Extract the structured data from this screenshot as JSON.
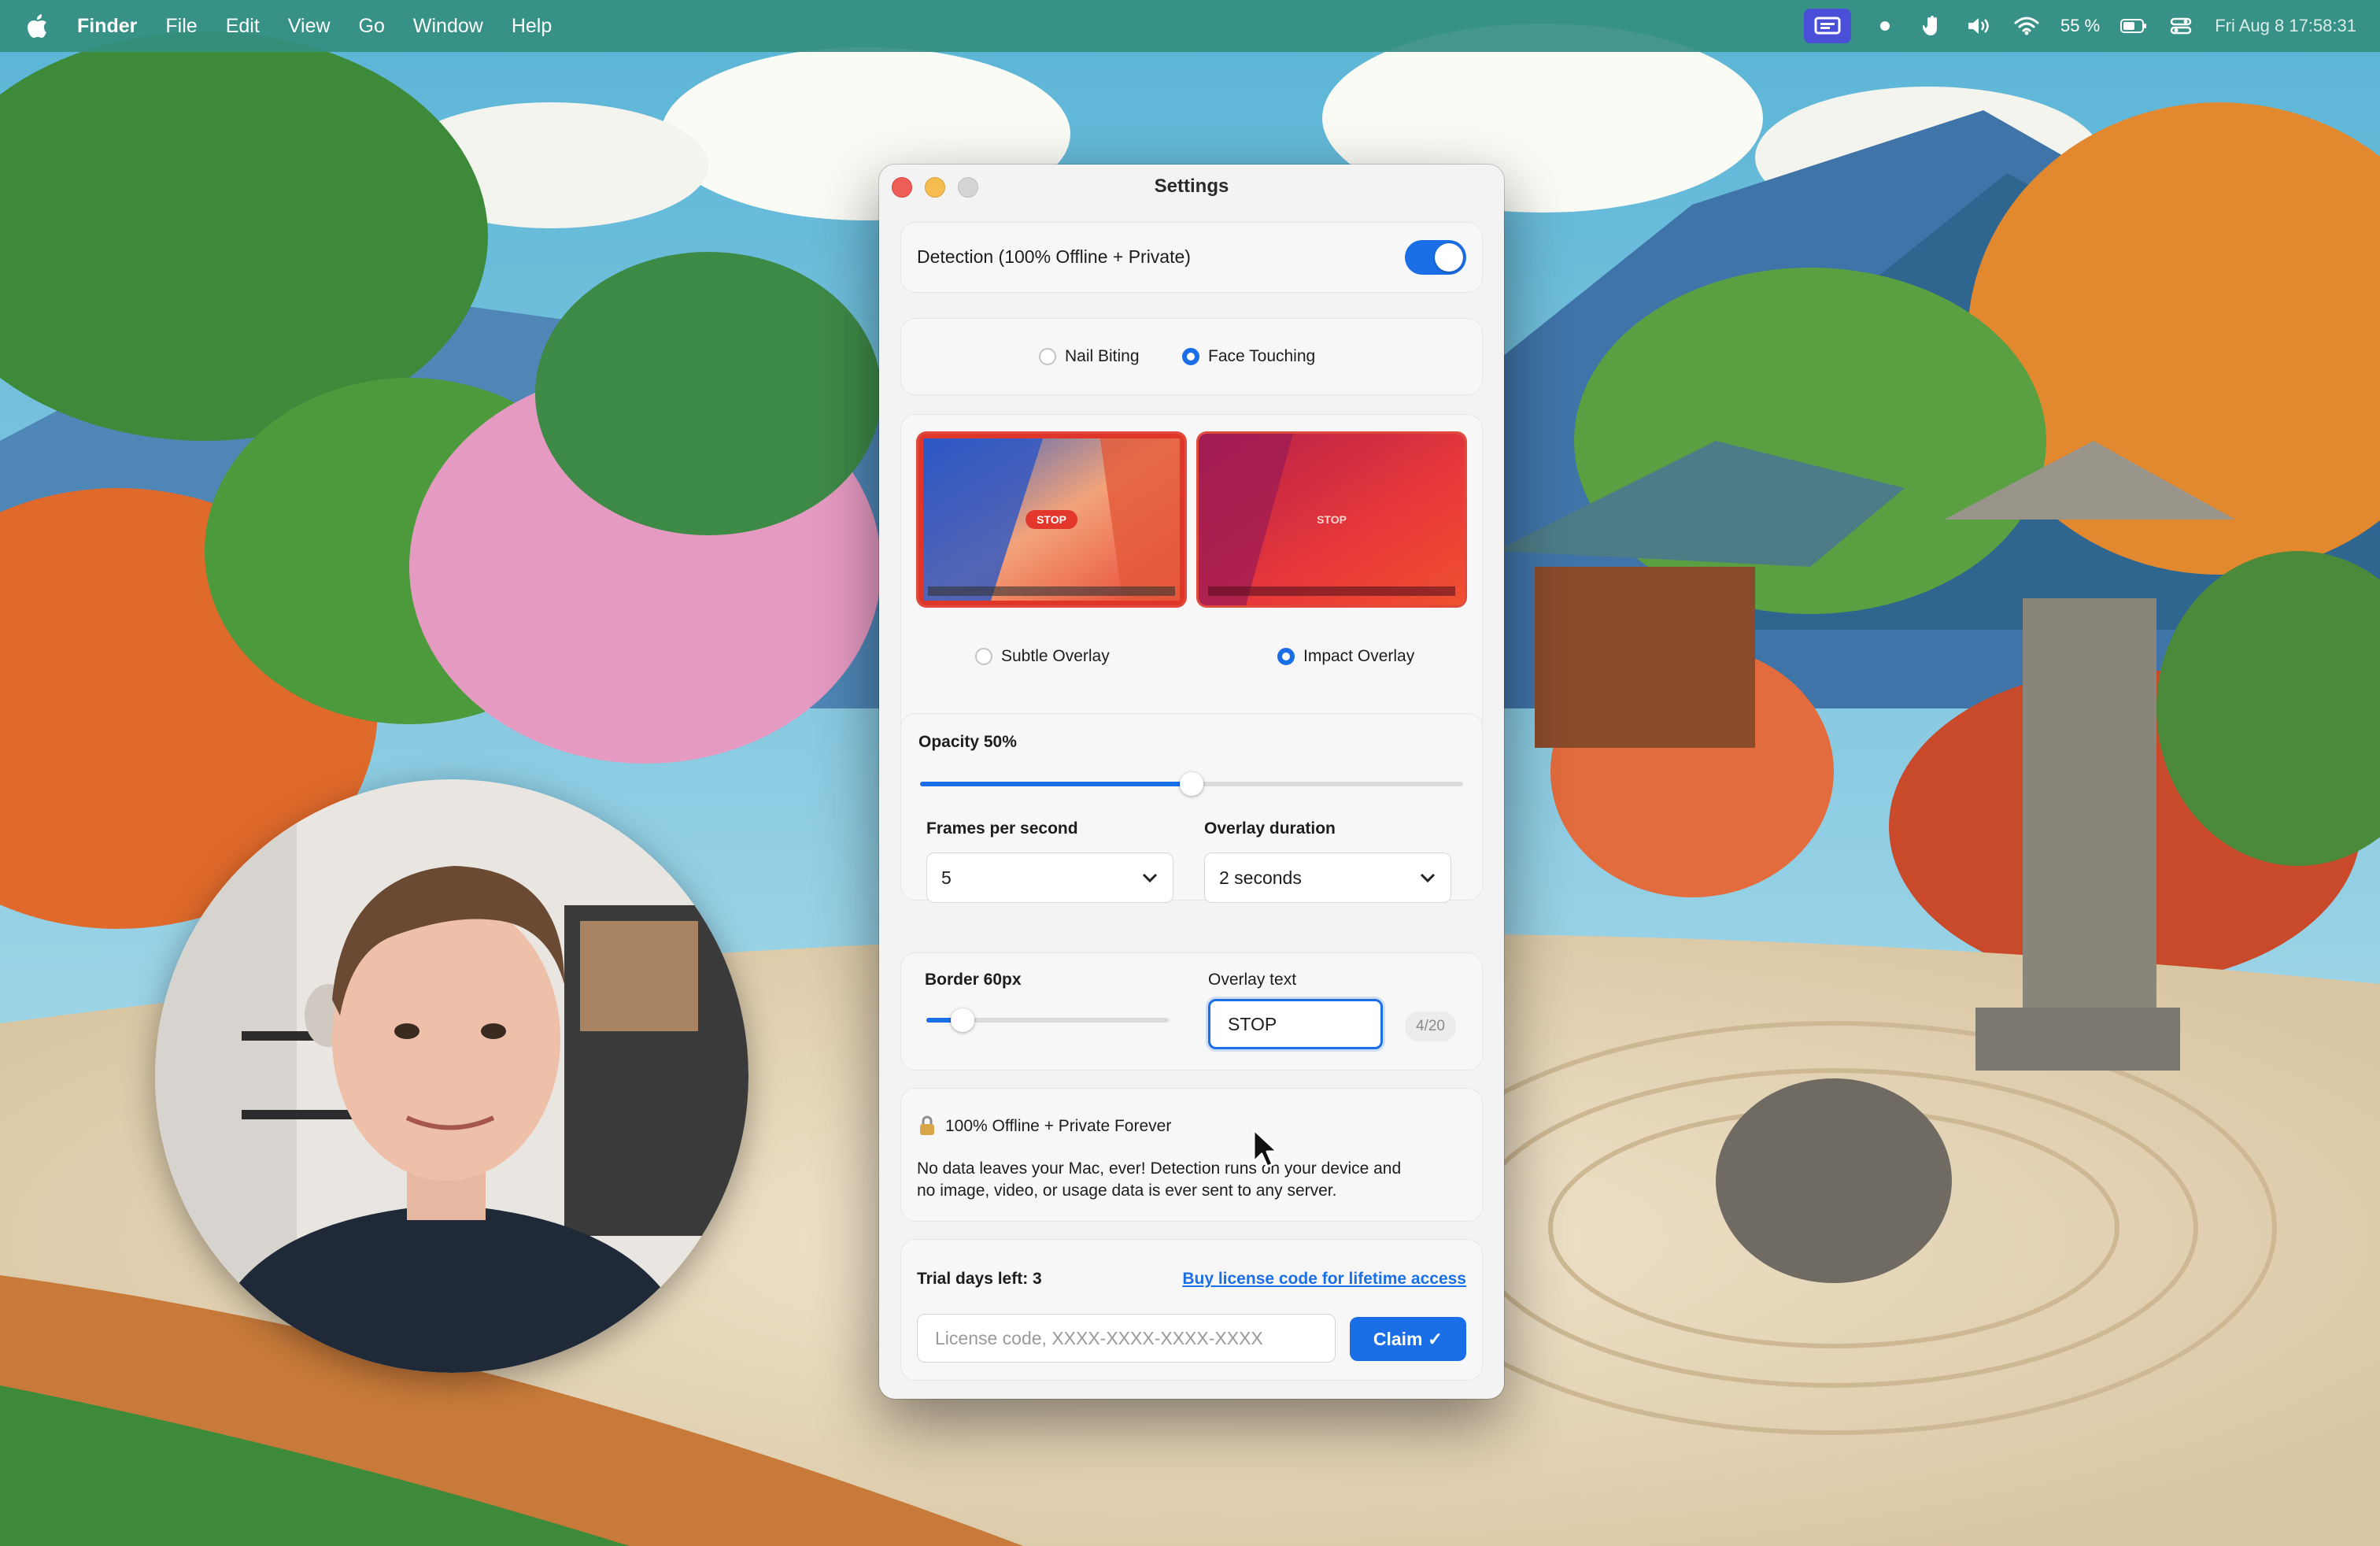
{
  "menubar": {
    "app_name": "Finder",
    "menus": [
      "File",
      "Edit",
      "View",
      "Go",
      "Window",
      "Help"
    ],
    "battery": "55 %",
    "clock": "Fri Aug 8  17:58:31"
  },
  "window": {
    "title": "Settings",
    "detection": {
      "label": "Detection (100% Offline + Private)",
      "enabled": true
    },
    "mode": {
      "options": [
        "Nail Biting",
        "Face Touching"
      ],
      "selected": "Face Touching"
    },
    "overlay_style": {
      "options": [
        "Subtle Overlay",
        "Impact Overlay"
      ],
      "selected": "Impact Overlay",
      "preview_text": "STOP"
    },
    "opacity": {
      "label": "Opacity 50%",
      "value": 0.5
    },
    "fps": {
      "label": "Frames per second",
      "value": "5"
    },
    "overlay_duration": {
      "label": "Overlay duration",
      "value": "2 seconds"
    },
    "border": {
      "label": "Border 60px",
      "value": 0.15
    },
    "overlay_text": {
      "label": "Overlay text",
      "value": "STOP",
      "counter": "4/20"
    },
    "privacy": {
      "title": "100% Offline + Private Forever",
      "body_line1": "No data leaves your Mac, ever! Detection runs on your device and",
      "body_line2": "no image, video, or usage data is ever sent to any server."
    },
    "trial": {
      "label": "Trial days left: 3",
      "buy_link": "Buy license code for lifetime access",
      "license_placeholder": "License code, XXXX-XXXX-XXXX-XXXX",
      "claim_label": "Claim ✓"
    }
  },
  "colors": {
    "accent": "#1a6fe6",
    "menubar": "#348e80"
  },
  "icons": [
    "apple-icon",
    "screen-record-icon",
    "hand-icon",
    "volume-icon",
    "wifi-icon",
    "battery-icon",
    "control-center-icon",
    "lock-icon",
    "chevron-down-icon",
    "cursor-icon"
  ]
}
